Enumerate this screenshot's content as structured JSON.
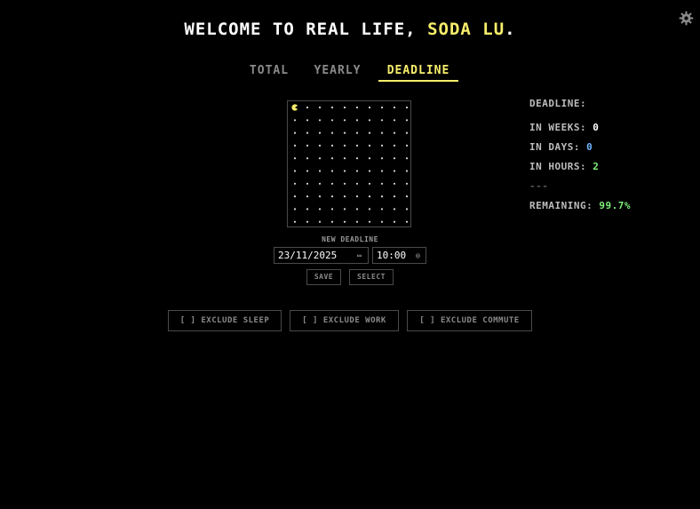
{
  "settings": {
    "icon": "gear-icon"
  },
  "header": {
    "prefix": "WELCOME TO REAL LIFE, ",
    "name": "SODA LU",
    "suffix": "."
  },
  "tabs": [
    {
      "label": "TOTAL",
      "active": false
    },
    {
      "label": "YEARLY",
      "active": false
    },
    {
      "label": "DEADLINE",
      "active": true
    }
  ],
  "grid": {
    "rows": 10,
    "cols": 10,
    "current_cell_icon": "pacman-icon"
  },
  "deadline_form": {
    "label": "NEW DEADLINE",
    "date_value": "23/11/2025",
    "time_value": "10:00",
    "save_label": "SAVE",
    "select_label": "SELECT"
  },
  "stats": {
    "title": "DEADLINE:",
    "weeks_label": "IN WEEKS:",
    "weeks_value": "0",
    "days_label": "IN DAYS:",
    "days_value": "0",
    "hours_label": "IN HOURS:",
    "hours_value": "2",
    "separator": "---",
    "remaining_label": "REMAINING:",
    "remaining_value": "99.7%"
  },
  "toggles": [
    {
      "label": "[ ] EXCLUDE SLEEP"
    },
    {
      "label": "[ ] EXCLUDE WORK"
    },
    {
      "label": "[ ] EXCLUDE COMMUTE"
    }
  ],
  "colors": {
    "background": "#000000",
    "accent_yellow": "#f7ee6a",
    "days_blue": "#6fb6ff",
    "hours_green": "#7ff07a"
  }
}
